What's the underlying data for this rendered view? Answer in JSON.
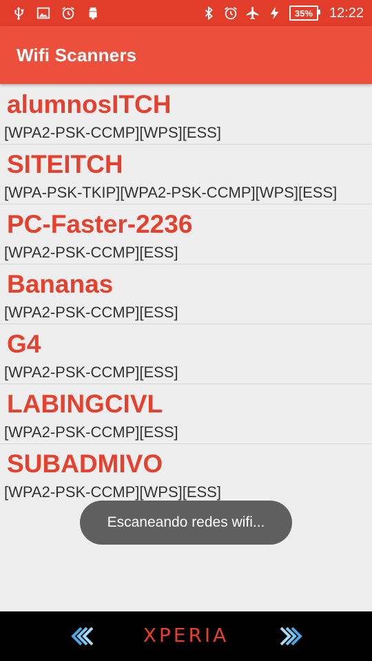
{
  "status_bar": {
    "left_icons": [
      "usb-icon",
      "image-icon",
      "alarm-clock-icon",
      "android-icon"
    ],
    "right_icons": [
      "bluetooth-icon",
      "alarm-icon",
      "airplane-mode-icon",
      "charging-icon"
    ],
    "battery": "35%",
    "time": "12:22"
  },
  "app_bar": {
    "title": "Wifi Scanners"
  },
  "networks": [
    {
      "ssid": "alumnosITCH",
      "capabilities": "[WPA2-PSK-CCMP][WPS][ESS]"
    },
    {
      "ssid": "SITEITCH",
      "capabilities": "[WPA-PSK-TKIP][WPA2-PSK-CCMP][WPS][ESS]"
    },
    {
      "ssid": "PC-Faster-2236",
      "capabilities": "[WPA2-PSK-CCMP][ESS]"
    },
    {
      "ssid": "Bananas",
      "capabilities": "[WPA2-PSK-CCMP][ESS]"
    },
    {
      "ssid": "G4",
      "capabilities": "[WPA2-PSK-CCMP][ESS]"
    },
    {
      "ssid": "LABINGCIVL",
      "capabilities": "[WPA2-PSK-CCMP][ESS]"
    },
    {
      "ssid": "SUBADMIVO",
      "capabilities": "[WPA2-PSK-CCMP][WPS][ESS]"
    }
  ],
  "toast": {
    "message": "Escaneando redes wifi..."
  },
  "nav_bar": {
    "brand": "XPERIA",
    "back_icon": "back-chevrons-icon",
    "forward_icon": "forward-chevrons-icon"
  },
  "colors": {
    "status_bar": "#e23d2b",
    "app_bar": "#ec503c",
    "ssid_text": "#e4412f",
    "background": "#eeeeee"
  }
}
